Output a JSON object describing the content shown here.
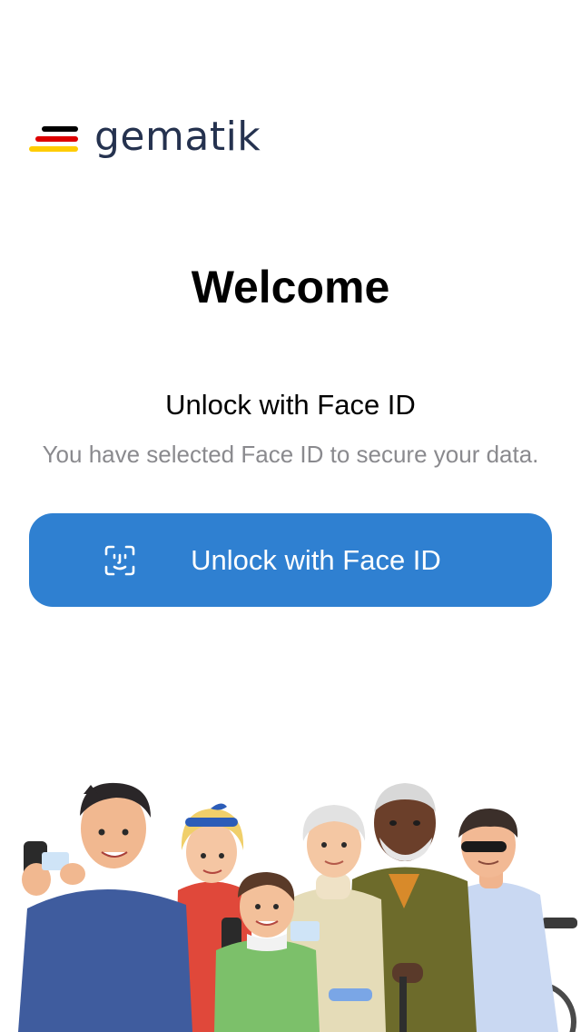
{
  "brand": {
    "name": "gematik",
    "text_color": "#25324f",
    "stripe_colors": [
      "#000000",
      "#dd0000",
      "#ffcc00"
    ]
  },
  "header": {
    "title": "Welcome"
  },
  "auth": {
    "method_title": "Unlock with Face ID",
    "method_description": "You have selected Face ID to secure your data.",
    "button_label": "Unlock with Face ID",
    "button_icon": "face-id-icon",
    "button_color": "#2f80d1"
  },
  "illustration": {
    "subject": "people-group-illustration"
  }
}
